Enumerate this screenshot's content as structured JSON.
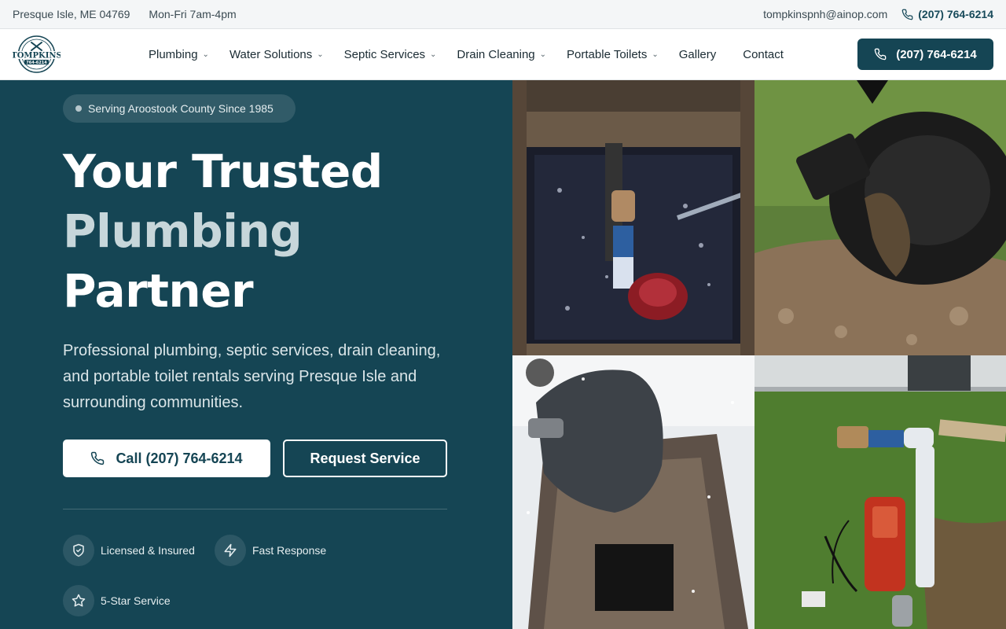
{
  "topbar": {
    "location": "Presque Isle, ME 04769",
    "hours": "Mon-Fri 7am-4pm",
    "email": "tompkinspnh@ainop.com",
    "phone": "(207) 764-6214"
  },
  "logo": {
    "brand": "TOMPKINS",
    "phone": "764-6214"
  },
  "nav": {
    "items": [
      {
        "label": "Plumbing",
        "dropdown": true
      },
      {
        "label": "Water Solutions",
        "dropdown": true
      },
      {
        "label": "Septic Services",
        "dropdown": true
      },
      {
        "label": "Drain Cleaning",
        "dropdown": true
      },
      {
        "label": "Portable Toilets",
        "dropdown": true
      },
      {
        "label": "Gallery",
        "dropdown": false
      },
      {
        "label": "Contact",
        "dropdown": false
      }
    ],
    "cta_label": "(207) 764-6214"
  },
  "hero": {
    "badge": "Serving Aroostook County Since 1985",
    "headline_1": "Your Trusted",
    "headline_2": "Plumbing",
    "headline_3": "Partner",
    "lead": "Professional plumbing, septic services, drain cleaning, and portable toilet rentals serving Presque Isle and surrounding communities.",
    "call_button": "Call (207) 764-6214",
    "request_button": "Request Service",
    "features": [
      {
        "icon": "shield-check-icon",
        "label": "Licensed & Insured"
      },
      {
        "icon": "lightning-icon",
        "label": "Fast Response"
      },
      {
        "icon": "star-icon",
        "label": "5-Star Service"
      }
    ]
  },
  "photos": [
    {
      "subject": "sump-pump-pit-photo"
    },
    {
      "subject": "septic-pipe-clog-photo"
    },
    {
      "subject": "winter-excavation-photo"
    },
    {
      "subject": "grinder-pump-install-photo"
    }
  ],
  "colors": {
    "brand": "#154554",
    "hero_text_muted": "#c7d6da",
    "page_bg": "#f4f6f7"
  }
}
